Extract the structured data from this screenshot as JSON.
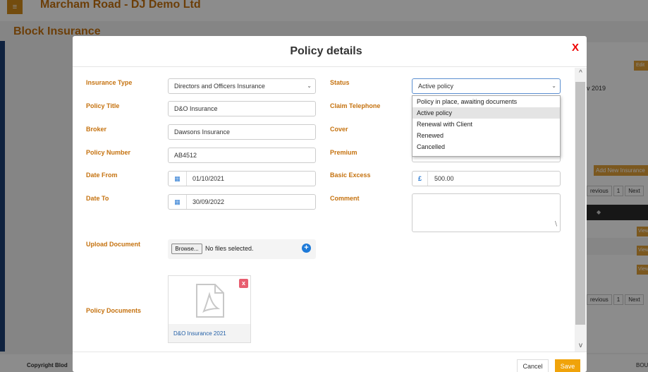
{
  "background": {
    "site_title": "Marcham Road - DJ Demo Ltd",
    "page_heading": "Block Insurance",
    "menu_icon": "hamburger-icon",
    "edit_label": "Edit",
    "date_fragment": "v 2019",
    "add_new_label": "Add New Insurance",
    "pager": {
      "previous": "revious",
      "page": "1",
      "next": "Next"
    },
    "table_sort_icon": "sort-icon",
    "view_label": "View",
    "footer_copyright": "Copyright Blod",
    "footer_right": "BOU"
  },
  "modal": {
    "title": "Policy details",
    "close_label": "X",
    "fields": {
      "insurance_type": {
        "label": "Insurance Type",
        "value": "Directors and Officers Insurance"
      },
      "policy_title": {
        "label": "Policy Title",
        "value": "D&O Insurance"
      },
      "broker": {
        "label": "Broker",
        "value": "Dawsons Insurance"
      },
      "policy_number": {
        "label": "Policy Number",
        "value": "AB4512"
      },
      "date_from": {
        "label": "Date From",
        "value": "01/10/2021",
        "icon": "calendar-icon"
      },
      "date_to": {
        "label": "Date To",
        "value": "30/09/2022",
        "icon": "calendar-icon"
      },
      "status": {
        "label": "Status",
        "value": "Active policy"
      },
      "claim_telephone": {
        "label": "Claim Telephone",
        "value": ""
      },
      "cover": {
        "label": "Cover",
        "value": ""
      },
      "premium": {
        "label": "Premium",
        "value": ""
      },
      "basic_excess": {
        "label": "Basic Excess",
        "currency": "£",
        "value": "500.00"
      },
      "comment": {
        "label": "Comment",
        "value": ""
      },
      "upload_document": {
        "label": "Upload Document",
        "browse_label": "Browse...",
        "file_status": "No files selected."
      },
      "policy_documents": {
        "label": "Policy Documents"
      }
    },
    "status_options": [
      "Policy in place, awaiting documents",
      "Active policy",
      "Renewal with Client",
      "Renewed",
      "Cancelled"
    ],
    "status_selected_index": 1,
    "documents": [
      {
        "name": "D&O Insurance 2021",
        "icon": "pdf-icon",
        "delete_label": "x"
      }
    ],
    "footer": {
      "cancel_label": "Cancel",
      "save_label": "Save"
    }
  },
  "colors": {
    "accent": "#c5720f",
    "save_button": "#f0a30a",
    "close": "#ee0000",
    "link": "#2460a7"
  }
}
